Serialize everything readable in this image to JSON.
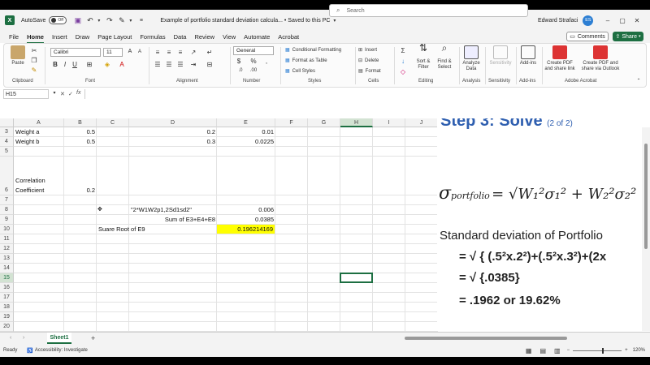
{
  "titlebar": {
    "autosave_label": "AutoSave",
    "autosave_state": "Off",
    "doc_title": "Example of portfolio standard deviation calcula... • Saved to this PC",
    "search_placeholder": "Search",
    "user_name": "Edward Strafaci",
    "user_initials": "ES"
  },
  "menu": {
    "tabs": [
      "File",
      "Home",
      "Insert",
      "Draw",
      "Page Layout",
      "Formulas",
      "Data",
      "Review",
      "View",
      "Automate",
      "Acrobat"
    ],
    "active": "Home",
    "comments_label": "Comments",
    "share_label": "Share"
  },
  "ribbon": {
    "clipboard": {
      "paste": "Paste",
      "label": "Clipboard"
    },
    "font": {
      "name": "Calibri",
      "size": "11",
      "label": "Font"
    },
    "alignment": {
      "label": "Alignment"
    },
    "number": {
      "format": "General",
      "label": "Number"
    },
    "styles": {
      "conditional": "Conditional Formatting",
      "format_table": "Format as Table",
      "cell_styles": "Cell Styles",
      "label": "Styles"
    },
    "cells": {
      "insert": "Insert",
      "delete": "Delete",
      "format": "Format",
      "label": "Cells"
    },
    "editing": {
      "sort": "Sort &",
      "filter": "Filter",
      "find": "Find &",
      "select": "Select",
      "label": "Editing"
    },
    "analysis": {
      "analyze": "Analyze",
      "data": "Data",
      "label": "Analysis"
    },
    "sensitivity": {
      "name": "Sensitivity",
      "label": "Sensitivity"
    },
    "addins": {
      "name": "Add-ins",
      "label": "Add-ins"
    },
    "acrobat": {
      "create_pdf_1": "Create PDF",
      "create_pdf_2": "and share link",
      "create_pdf_3": "Create PDF and",
      "create_pdf_4": "share via Outlook",
      "label": "Adobe Acrobat"
    }
  },
  "formula_bar": {
    "name_box": "H15",
    "fx": "fx",
    "content": ""
  },
  "grid": {
    "columns": [
      "A",
      "B",
      "C",
      "D",
      "E",
      "F",
      "G",
      "H",
      "I",
      "J"
    ],
    "rows": [
      "3",
      "4",
      "5",
      "",
      "6",
      "7",
      "8",
      "9",
      "10",
      "11",
      "12",
      "13",
      "14",
      "15",
      "16",
      "17",
      "18",
      "19",
      "20"
    ],
    "cells": {
      "A3": "Weight a",
      "B3": "0.5",
      "D3": "0.2",
      "E3": "0.01",
      "A4": "Weight b",
      "B4": "0.5",
      "D4": "0.3",
      "E4": "0.0225",
      "A6a": "Correlation",
      "A6b": "Coefficient",
      "B6": "0.2",
      "D8": "\"2*W1W2p1,2Sd1sd2\"",
      "E8": "0.006",
      "D9": "Sum of E3+E4+E8",
      "E9": "0.0385",
      "C10": "Suare Root of E9",
      "E10": "0.196214169"
    },
    "selected_cell": "H15",
    "highlight_color": "#ffff00"
  },
  "overlay": {
    "step_title": "Step 3: Solve",
    "step_suffix": "(2 of 2)",
    "sigma": "σ",
    "portfolio_sub": "portfolio",
    "formula_text": "= √W₁²σ₁² + W₂²σ₂² +",
    "heading": "Standard deviation of Portfolio",
    "line1": "= √ { (.5²x.2²)+(.5²x.3²)+(2x",
    "line2": "= √ {.0385}",
    "line3": "= .1962 or 19.62%"
  },
  "sheet_tabs": {
    "active": "Sheet1",
    "add": "+"
  },
  "status": {
    "ready": "Ready",
    "accessibility": "Accessibility: Investigate",
    "zoom": "120%"
  },
  "colors": {
    "excel_green": "#1d6f42",
    "highlight": "#ffff00",
    "avatar": "#2d7fd3"
  }
}
